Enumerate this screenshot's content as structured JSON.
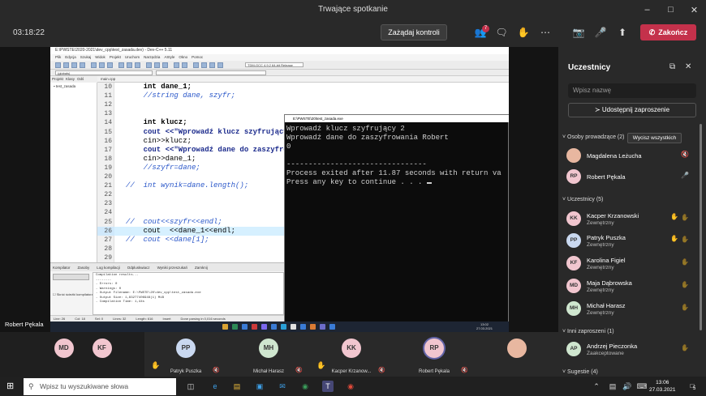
{
  "window": {
    "title": "Trwające spotkanie"
  },
  "toolbar": {
    "timer": "03:18:22",
    "request_control": "Zażądaj kontroli",
    "participants_badge": "7",
    "leave": "Zakończ"
  },
  "ide": {
    "title": "E:\\PWSTE\\2020-2021\\dev_cpp\\test_zasada.dev) - Dev-C++ 5.11",
    "menu": [
      "Plik",
      "Edycja",
      "Szukaj",
      "Widok",
      "Projekt",
      "Uruchom",
      "Narzędzia",
      "AStyle",
      "Okno",
      "Pomoc"
    ],
    "compiler_combo": "TDM-GCC 4.9.2 64-bit Release",
    "globals_combo": "(globals)",
    "proj_tabs": [
      "Projekt",
      "Klasy",
      "Odś"
    ],
    "proj_item": "test_zasada",
    "file_tab": "main.cpp",
    "code_lines": [
      {
        "n": "10",
        "t": "    int dane_1;"
      },
      {
        "n": "11",
        "t": "    //string dane, szyfr;"
      },
      {
        "n": "12",
        "t": ""
      },
      {
        "n": "13",
        "t": ""
      },
      {
        "n": "14",
        "t": "    int klucz;"
      },
      {
        "n": "15",
        "t": "    cout <<\"Wprowadź klucz szyfrujący \";"
      },
      {
        "n": "16",
        "t": "    cin>>klucz;"
      },
      {
        "n": "17",
        "t": "    cout <<\"Wprowadź dane do zaszyfrowania\";"
      },
      {
        "n": "18",
        "t": "    cin>>dane_1;"
      },
      {
        "n": "19",
        "t": "    //szyfr=dane;"
      },
      {
        "n": "20",
        "t": ""
      },
      {
        "n": "21",
        "t": "//  int wynik=dane.length();"
      },
      {
        "n": "22",
        "t": ""
      },
      {
        "n": "23",
        "t": ""
      },
      {
        "n": "24",
        "t": ""
      },
      {
        "n": "25",
        "t": "//  cout<<szyfr<<endl;"
      },
      {
        "n": "26",
        "t": "    cout  <<dane_1<<endl;"
      },
      {
        "n": "27",
        "t": "//  cout <<dane[1];"
      },
      {
        "n": "28",
        "t": ""
      },
      {
        "n": "29",
        "t": ""
      }
    ],
    "bottom_tabs": [
      "Kompilator",
      "Zasoby",
      "Log kompilacji",
      "Odpluskwiacz",
      "Wyniki przeszukań",
      "Zamknij"
    ],
    "abort_label": "",
    "shorten_label": "Skróć ścieżki kompilatora",
    "log_lines": [
      "Compilation results...",
      "--------",
      "- Errors: 0",
      "- Warnings: 0",
      "- Output Filename: E:\\PWSTE\\20\\dev_cpp\\test_zasada.exe",
      "- Output Size: 1,83277406948(1) MiB",
      "- Compilation Time: 1,44s"
    ],
    "status": [
      "Line:   26",
      "Col:   18",
      "Sel:   0",
      "Lines:   32",
      "Length:   616",
      "Insert",
      "Done parsing in 0,016 seconds"
    ]
  },
  "console": {
    "title": "E:\\PWSTE\\20\\test_zasada.exe",
    "lines": [
      "Wprowadź klucz szyfrujący 2",
      "Wprowadź dane do zaszyfrowania Robert",
      "0",
      "",
      "--------------------------------",
      "Process exited after 11.87 seconds with return va",
      "Press any key to continue . . . "
    ]
  },
  "shared_clock": {
    "time": "13:02",
    "date": "27.03.2021"
  },
  "presenter_name": "Robert Pękala",
  "people": {
    "title": "Uczestnicy",
    "search_placeholder": "Wpisz nazwę",
    "share_invite": "Udostępnij zaproszenie",
    "presenters_header": "Osoby prowadzące (2)",
    "mute_all": "Wycisz wszystkich",
    "presenters": [
      {
        "initials": "",
        "name": "Magdalena Leżucha",
        "sub": "",
        "color": "#e8b7a0"
      },
      {
        "initials": "RP",
        "name": "Robert Pękala",
        "sub": "",
        "color": "#f1c6cf"
      }
    ],
    "attendees_header": "Uczestnicy (5)",
    "attendees": [
      {
        "initials": "KK",
        "name": "Kacper Krzanowski",
        "sub": "Zewnętrzny",
        "color": "#f1c6cf",
        "hand": true
      },
      {
        "initials": "PP",
        "name": "Patryk Puszka",
        "sub": "Zewnętrzny",
        "color": "#c9d8f0",
        "hand": true
      },
      {
        "initials": "KF",
        "name": "Karolina Figiel",
        "sub": "Zewnętrzny",
        "color": "#f1c6cf",
        "hand": false
      },
      {
        "initials": "MD",
        "name": "Maja Dąbrowska",
        "sub": "Zewnętrzny",
        "color": "#f1c6cf",
        "hand": false
      },
      {
        "initials": "MH",
        "name": "Michał Harasz",
        "sub": "Zewnętrzny",
        "color": "#cfe6cf",
        "hand": false
      }
    ],
    "others_header": "Inni zaproszeni (1)",
    "others": [
      {
        "initials": "AP",
        "name": "Andrzej Pieczonka",
        "sub": "Zaakceptowane",
        "color": "#cfe6cf"
      }
    ],
    "suggestions_header": "Sugestie (4)"
  },
  "gallery": [
    {
      "initials": "MD",
      "name": "",
      "color": "#f1c6cf",
      "hand": false
    },
    {
      "initials": "KF",
      "name": "",
      "color": "#f1c6cf",
      "hand": false
    },
    {
      "initials": "PP",
      "name": "Patryk Puszka",
      "color": "#c9d8f0",
      "hand": true
    },
    {
      "initials": "MH",
      "name": "Michał Harasz",
      "color": "#cfe6cf",
      "hand": false
    },
    {
      "initials": "KK",
      "name": "Kacper Krzanow...",
      "color": "#f1c6cf",
      "hand": true
    },
    {
      "initials": "RP",
      "name": "Robert Pękala",
      "color": "#f1c6cf",
      "hand": false
    },
    {
      "initials": "",
      "name": "",
      "color": "#e8b7a0",
      "hand": false
    }
  ],
  "taskbar": {
    "search_placeholder": "Wpisz tu wyszukiwane słowa",
    "time": "13:06",
    "date": "27.03.2021",
    "notif_count": "5"
  },
  "colors": {
    "leave_red": "#c4314b",
    "teams_bg": "#292929",
    "hand": "#f3c33a"
  }
}
